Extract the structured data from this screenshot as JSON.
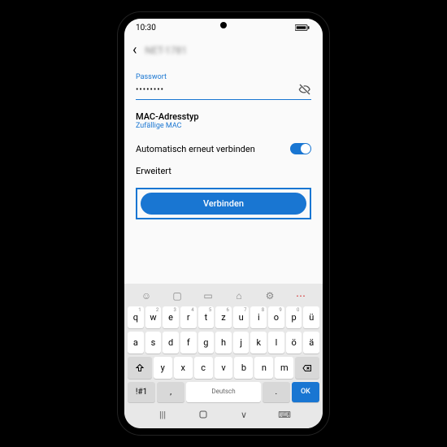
{
  "status": {
    "time": "10:30"
  },
  "header": {
    "network_name": "NET-1781"
  },
  "wifi": {
    "password_label": "Passwort",
    "password_value": "••••••••",
    "mac_label": "MAC-Adresstyp",
    "mac_value": "Zufällige MAC",
    "auto_reconnect_label": "Automatisch erneut verbinden",
    "advanced_label": "Erweitert",
    "connect_label": "Verbinden"
  },
  "keyboard": {
    "row1": [
      "q",
      "w",
      "e",
      "r",
      "t",
      "z",
      "u",
      "i",
      "o",
      "p",
      "ü"
    ],
    "row1_nums": [
      "1",
      "2",
      "3",
      "4",
      "5",
      "6",
      "7",
      "8",
      "9",
      "0",
      ""
    ],
    "row2": [
      "a",
      "s",
      "d",
      "f",
      "g",
      "h",
      "j",
      "k",
      "l",
      "ö",
      "ä"
    ],
    "row3": [
      "y",
      "x",
      "c",
      "v",
      "b",
      "n",
      "m"
    ],
    "mode_key": "!#1",
    "lang_key": "Deutsch",
    "comma_key": ",",
    "period_key": ".",
    "ok_key": "OK"
  }
}
